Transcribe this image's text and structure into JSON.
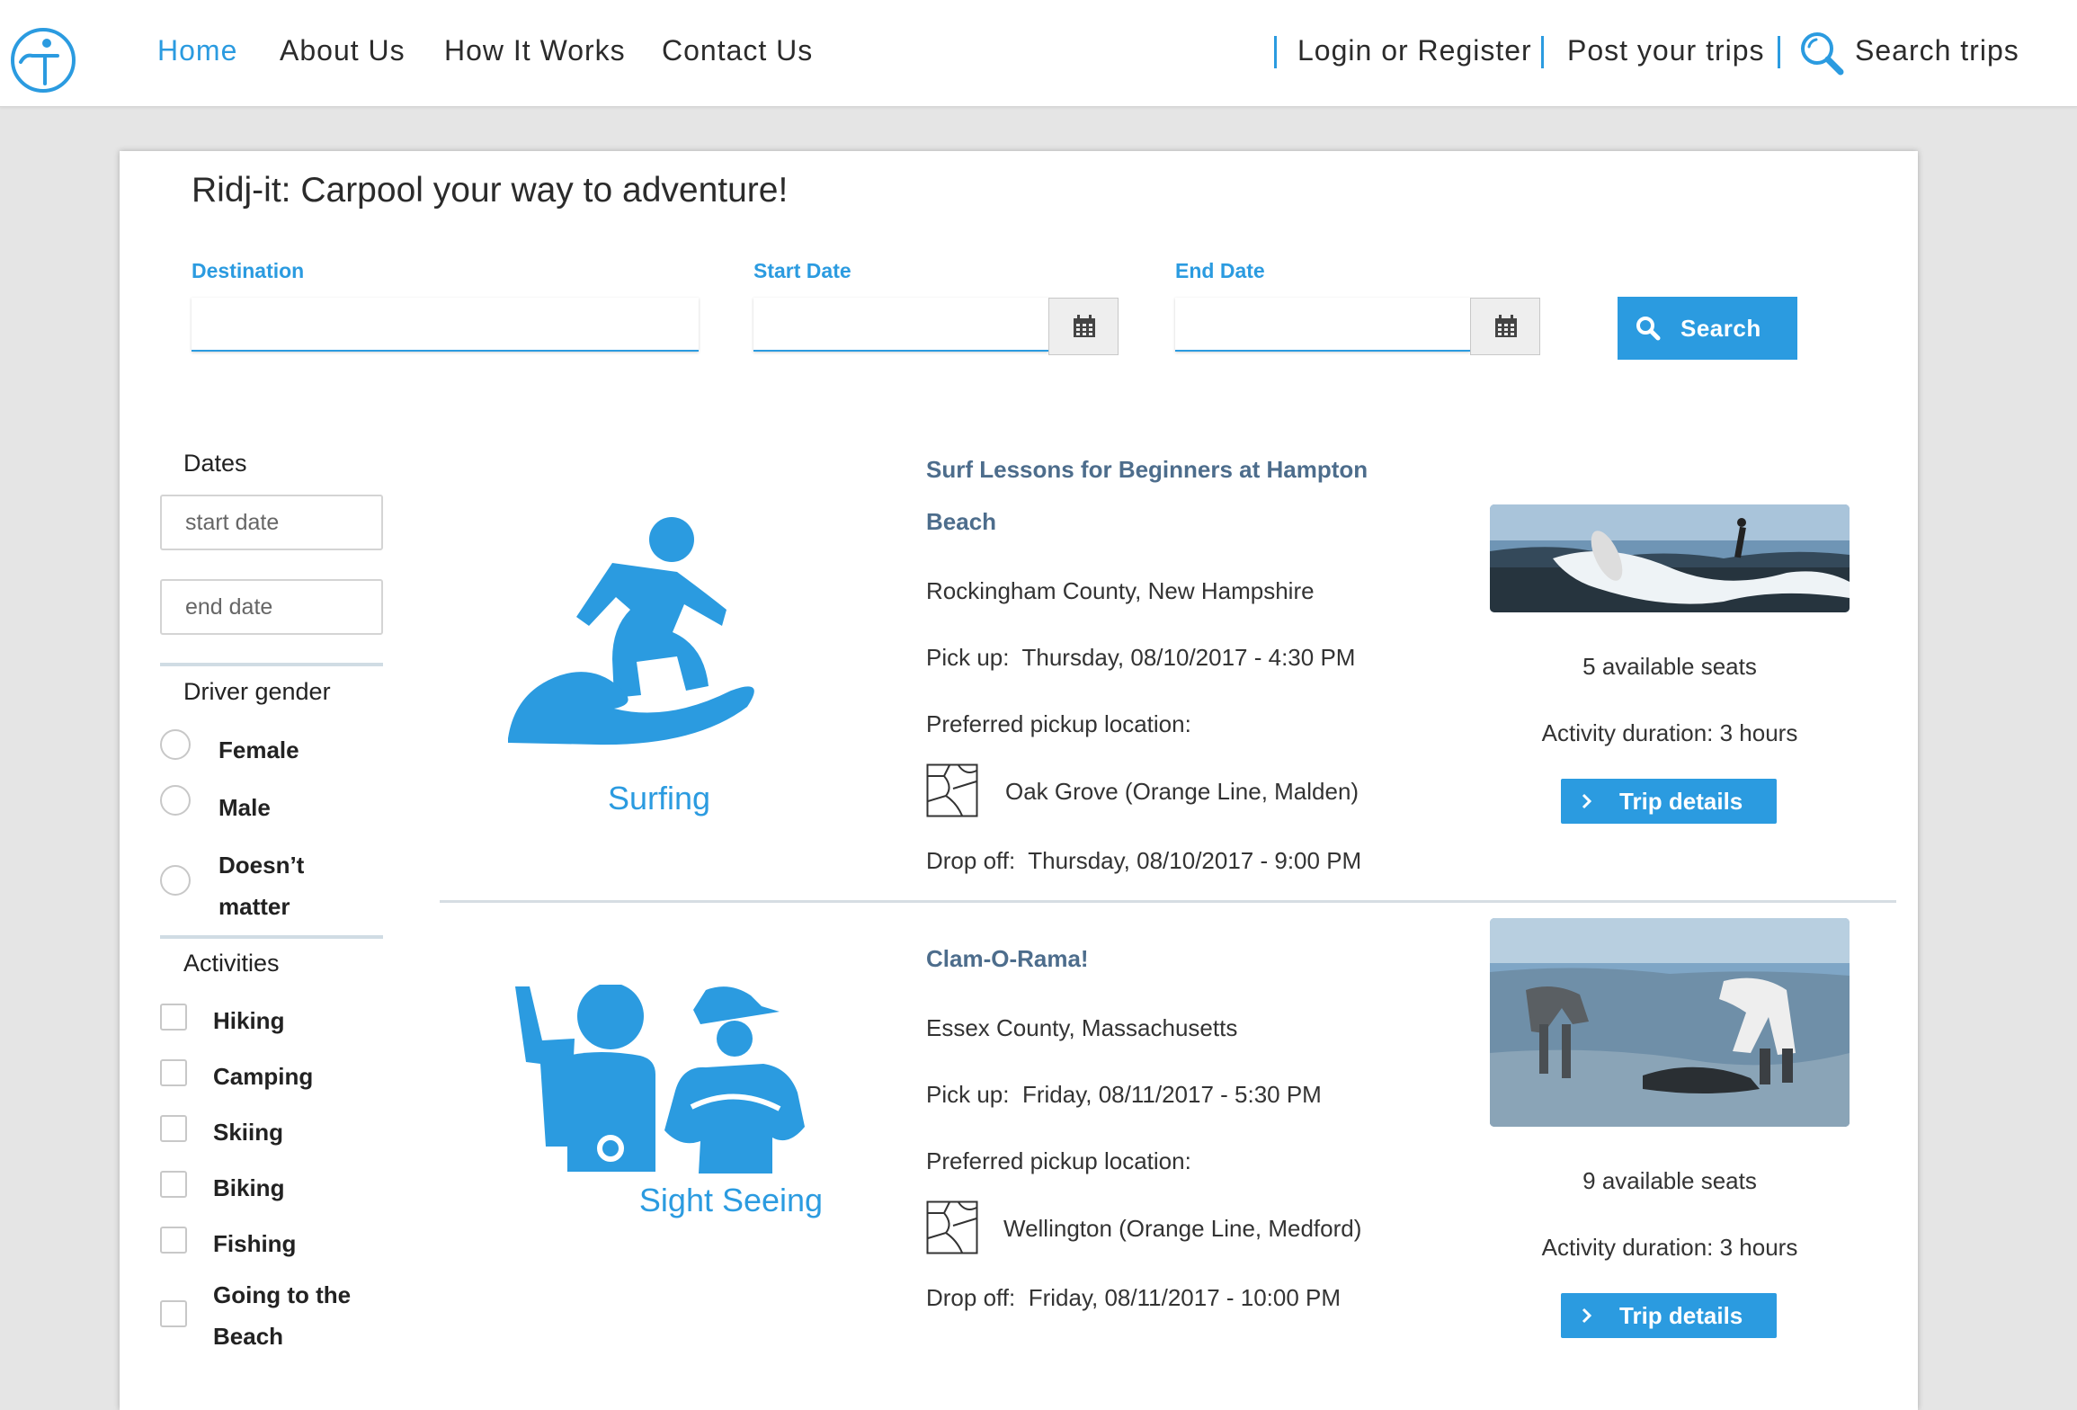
{
  "header": {
    "nav": [
      {
        "label": "Home",
        "active": true
      },
      {
        "label": "About Us"
      },
      {
        "label": "How It Works"
      },
      {
        "label": "Contact Us"
      }
    ],
    "login_label": "Login or Register",
    "post_label": "Post your trips",
    "search_label": "Search trips",
    "icons": {
      "logo": "person-logo-icon",
      "search": "magnifier-icon"
    }
  },
  "search_form": {
    "tagline": "Ridj-it: Carpool your way to adventure!",
    "destination_label": "Destination",
    "destination_value": "",
    "start_label": "Start Date",
    "start_value": "",
    "end_label": "End Date",
    "end_value": "",
    "search_button": "Search"
  },
  "filters": {
    "dates_heading": "Dates",
    "start_placeholder": "start date",
    "end_placeholder": "end date",
    "gender_heading": "Driver gender",
    "gender_options": [
      "Female",
      "Male",
      "Doesn’t matter"
    ],
    "activities_heading": "Activities",
    "activities": [
      "Hiking",
      "Camping",
      "Skiing",
      "Biking",
      "Fishing",
      "Going to the Beach"
    ]
  },
  "trips": [
    {
      "activity": "Surfing",
      "activity_icon": "surfer-icon",
      "title": "Surf Lessons for Beginners at Hampton Beach",
      "location": "Rockingham County, New Hampshire",
      "pickup_label": "Pick up:",
      "pickup": "Thursday, 08/10/2017 - 4:30 PM",
      "preferred_label": "Preferred pickup location:",
      "pickup_location": "Oak Grove (Orange Line, Malden)",
      "dropoff_label": "Drop off:",
      "dropoff": "Thursday, 08/10/2017 - 9:00 PM",
      "seats": "5 available seats",
      "duration": "Activity duration: 3 hours",
      "details_button": "Trip details"
    },
    {
      "activity": "Sight Seeing",
      "activity_icon": "sightseeing-icon",
      "title": "Clam-O-Rama!",
      "location": "Essex County, Massachusetts",
      "pickup_label": "Pick up:",
      "pickup": "Friday, 08/11/2017 - 5:30 PM",
      "preferred_label": "Preferred pickup location:",
      "pickup_location": "Wellington (Orange Line, Medford)",
      "dropoff_label": "Drop off:",
      "dropoff": "Friday, 08/11/2017 - 10:00 PM",
      "seats": "9 available seats",
      "duration": "Activity duration: 3 hours",
      "details_button": "Trip details"
    }
  ],
  "colors": {
    "accent": "#2b9be0",
    "title": "#4d6d8c",
    "background": "#e5e5e5"
  }
}
